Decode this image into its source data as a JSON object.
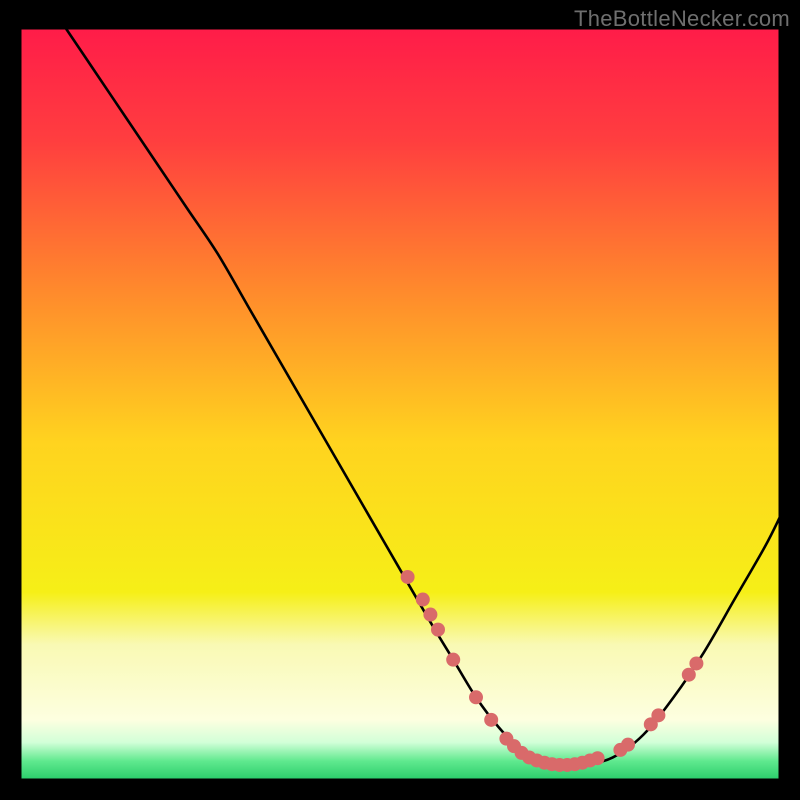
{
  "watermark": "TheBottleNecker.com",
  "chart_data": {
    "type": "line",
    "title": "",
    "xlabel": "",
    "ylabel": "",
    "xlim": [
      0,
      100
    ],
    "ylim": [
      0,
      100
    ],
    "background_gradient": {
      "stops": [
        {
          "offset": 0.0,
          "color": "#ff1c49"
        },
        {
          "offset": 0.15,
          "color": "#ff3e3f"
        },
        {
          "offset": 0.35,
          "color": "#ff8a2c"
        },
        {
          "offset": 0.55,
          "color": "#ffd31f"
        },
        {
          "offset": 0.75,
          "color": "#f6ef17"
        },
        {
          "offset": 0.82,
          "color": "#f9f9b4"
        },
        {
          "offset": 0.92,
          "color": "#fdffe0"
        },
        {
          "offset": 0.95,
          "color": "#d2ffd8"
        },
        {
          "offset": 0.975,
          "color": "#5fe98e"
        },
        {
          "offset": 1.0,
          "color": "#29cc6a"
        }
      ]
    },
    "series": [
      {
        "name": "curve",
        "color": "#000000",
        "x": [
          6,
          10,
          14,
          18,
          22,
          26,
          30,
          34,
          38,
          42,
          46,
          50,
          54,
          57,
          60,
          63,
          66,
          70,
          74,
          78,
          82,
          86,
          90,
          94,
          98,
          100
        ],
        "y": [
          100,
          94,
          88,
          82,
          76,
          70,
          63,
          56,
          49,
          42,
          35,
          28,
          21,
          16,
          11,
          7,
          4,
          2,
          2,
          3,
          6,
          11,
          17,
          24,
          31,
          35
        ]
      }
    ],
    "markers": {
      "color": "#d96a6a",
      "radius": 7,
      "points": [
        {
          "x": 51,
          "y": 27
        },
        {
          "x": 53,
          "y": 24
        },
        {
          "x": 54,
          "y": 22
        },
        {
          "x": 55,
          "y": 20
        },
        {
          "x": 57,
          "y": 16
        },
        {
          "x": 60,
          "y": 11
        },
        {
          "x": 62,
          "y": 8
        },
        {
          "x": 64,
          "y": 5.5
        },
        {
          "x": 65,
          "y": 4.5
        },
        {
          "x": 66,
          "y": 3.6
        },
        {
          "x": 67,
          "y": 3.0
        },
        {
          "x": 68,
          "y": 2.6
        },
        {
          "x": 69,
          "y": 2.3
        },
        {
          "x": 70,
          "y": 2.1
        },
        {
          "x": 71,
          "y": 2.0
        },
        {
          "x": 72,
          "y": 2.0
        },
        {
          "x": 73,
          "y": 2.1
        },
        {
          "x": 74,
          "y": 2.3
        },
        {
          "x": 75,
          "y": 2.6
        },
        {
          "x": 76,
          "y": 2.9
        },
        {
          "x": 79,
          "y": 4.0
        },
        {
          "x": 80,
          "y": 4.7
        },
        {
          "x": 83,
          "y": 7.4
        },
        {
          "x": 84,
          "y": 8.6
        },
        {
          "x": 88,
          "y": 14.0
        },
        {
          "x": 89,
          "y": 15.5
        }
      ]
    }
  }
}
